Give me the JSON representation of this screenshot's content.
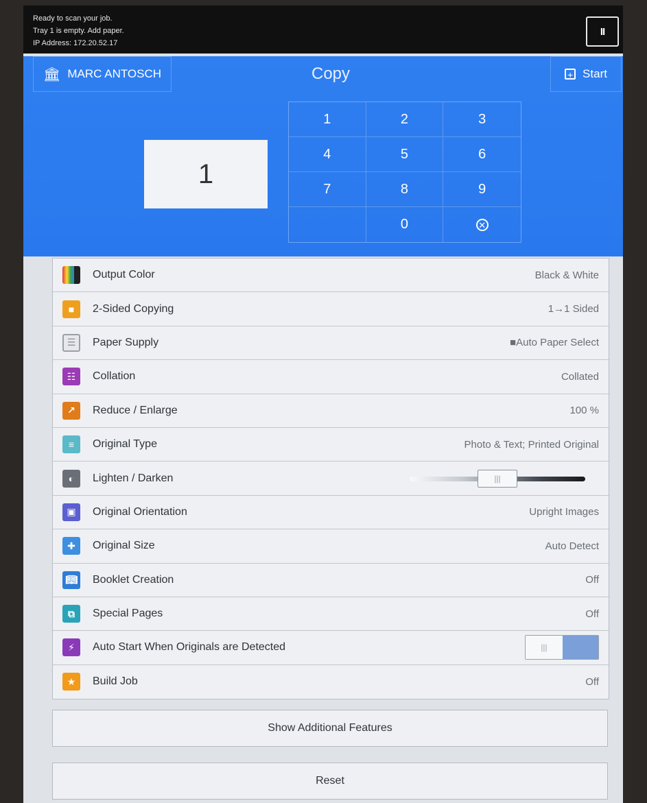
{
  "status": {
    "lines": [
      "Ready to scan your job.",
      "Tray 1 is empty.  Add paper.",
      "IP Address: 172.20.52.17"
    ],
    "pause_label": "II"
  },
  "header": {
    "user_name": "MARC ANTOSCH",
    "title": "Copy",
    "start_label": "Start",
    "quantity": "1"
  },
  "keypad": {
    "keys": [
      "1",
      "2",
      "3",
      "4",
      "5",
      "6",
      "7",
      "8",
      "9",
      "",
      "0"
    ],
    "clear_icon": "clear-icon"
  },
  "features": [
    {
      "label": "Output Color",
      "value": "Black & White",
      "icon": "output-color-icon"
    },
    {
      "label": "2-Sided Copying",
      "value": "1→1 Sided",
      "icon": "two-sided-icon"
    },
    {
      "label": "Paper Supply",
      "value": "■Auto Paper Select",
      "icon": "paper-supply-icon"
    },
    {
      "label": "Collation",
      "value": "Collated",
      "icon": "collation-icon"
    },
    {
      "label": "Reduce / Enlarge",
      "value": "100 %",
      "icon": "reduce-enlarge-icon"
    },
    {
      "label": "Original Type",
      "value": "Photo & Text; Printed Original",
      "icon": "original-type-icon"
    },
    {
      "label": "Lighten / Darken",
      "value": "",
      "icon": "lighten-darken-icon"
    },
    {
      "label": "Original Orientation",
      "value": "Upright Images",
      "icon": "orientation-icon"
    },
    {
      "label": "Original Size",
      "value": "Auto Detect",
      "icon": "original-size-icon"
    },
    {
      "label": "Booklet Creation",
      "value": "Off",
      "icon": "booklet-icon"
    },
    {
      "label": "Special Pages",
      "value": "Off",
      "icon": "special-pages-icon"
    },
    {
      "label": "Auto Start When Originals are Detected",
      "value": "",
      "icon": "auto-start-icon"
    },
    {
      "label": "Build Job",
      "value": "Off",
      "icon": "build-job-icon"
    }
  ],
  "lighten_darken_level": 0.5,
  "auto_start_on": true,
  "buttons": {
    "show_more": "Show Additional Features",
    "reset": "Reset"
  },
  "colors": {
    "header_blue": "#2f7ff0",
    "status_bg": "#101010",
    "toggle_on": "#7b9fd8"
  }
}
